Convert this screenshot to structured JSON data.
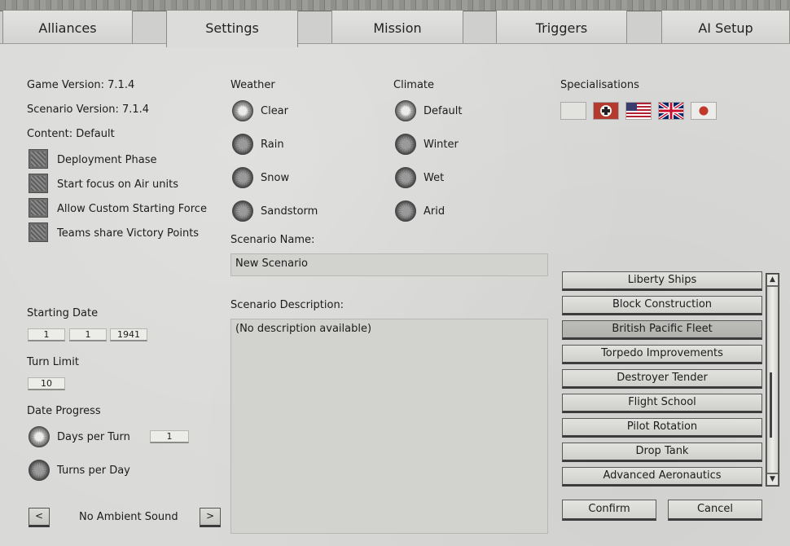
{
  "tabs": [
    "Alliances",
    "Settings",
    "Mission",
    "Triggers",
    "AI Setup"
  ],
  "info": {
    "game_version": "Game Version: 7.1.4",
    "scenario_version": "Scenario Version: 7.1.4",
    "content": "Content: Default"
  },
  "options": [
    {
      "label": "Deployment Phase"
    },
    {
      "label": "Start focus on Air units"
    },
    {
      "label": "Allow Custom Starting Force"
    },
    {
      "label": "Teams share Victory Points"
    }
  ],
  "weather": {
    "title": "Weather",
    "options": [
      "Clear",
      "Rain",
      "Snow",
      "Sandstorm"
    ],
    "selected": "Clear"
  },
  "climate": {
    "title": "Climate",
    "options": [
      "Default",
      "Winter",
      "Wet",
      "Arid"
    ],
    "selected": "Default"
  },
  "specialisations": {
    "title": "Specialisations",
    "flags": [
      "neutral-flag-icon",
      "german-cross-flag-icon",
      "usa-flag-icon",
      "uk-flag-icon",
      "japan-flag-icon"
    ]
  },
  "scenario": {
    "name_label": "Scenario Name:",
    "name_value": "New Scenario",
    "desc_label": "Scenario Description:",
    "desc_value": "(No description available)"
  },
  "start_date": {
    "label": "Starting Date",
    "day": "1",
    "month": "1",
    "year": "1941"
  },
  "turn_limit": {
    "label": "Turn Limit",
    "value": "10"
  },
  "date_progress": {
    "label": "Date Progress",
    "days_per_turn": "Days per Turn",
    "days_value": "1",
    "turns_per_day": "Turns per Day",
    "selected": "Days per Turn"
  },
  "sound": {
    "prev": "<",
    "label": "No Ambient Sound",
    "next": ">"
  },
  "spec_list": [
    "Liberty Ships",
    "Block Construction",
    "British Pacific Fleet",
    "Torpedo Improvements",
    "Destroyer Tender",
    "Flight School",
    "Pilot Rotation",
    "Drop Tank",
    "Advanced Aeronautics"
  ],
  "spec_list_selected": "British Pacific Fleet",
  "buttons": {
    "confirm": "Confirm",
    "cancel": "Cancel"
  },
  "colors": {
    "panel": "#d9d9d7",
    "button_border": "#3d3d3d"
  }
}
